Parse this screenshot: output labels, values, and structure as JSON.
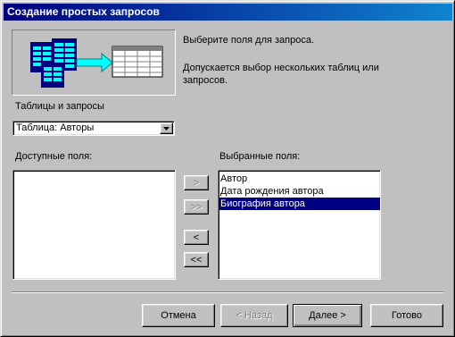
{
  "window": {
    "title": "Создание простых запросов"
  },
  "intro": {
    "line1": "Выберите поля для запроса.",
    "line2": "Допускается выбор нескольких таблиц или",
    "line3": "запросов."
  },
  "tables": {
    "label": "Таблицы и запросы",
    "selected": "Таблица: Авторы"
  },
  "available": {
    "label": "Доступные поля:",
    "items": []
  },
  "selected_fields": {
    "label": "Выбранные поля:",
    "items": [
      {
        "text": "Автор",
        "selected": false
      },
      {
        "text": "Дата рождения автора",
        "selected": false
      },
      {
        "text": "Биография автора",
        "selected": true
      }
    ]
  },
  "move_buttons": {
    "add_one": ">",
    "add_all": ">>",
    "remove_one": "<",
    "remove_all": "<<"
  },
  "footer": {
    "cancel": "Отмена",
    "back": "< Назад",
    "next": "Далее >",
    "finish": "Готово"
  }
}
